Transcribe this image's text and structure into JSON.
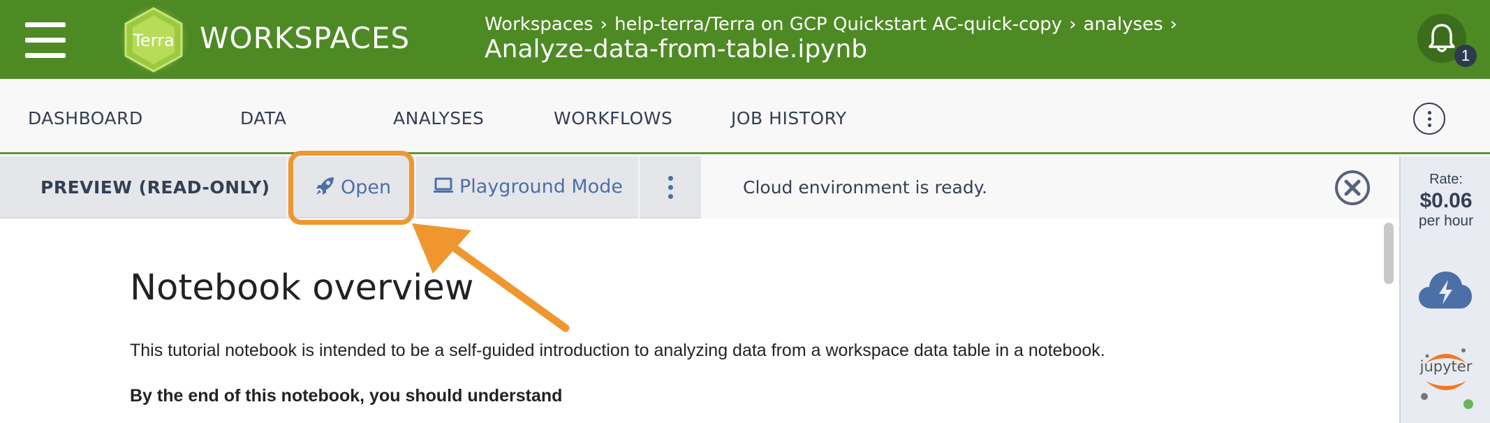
{
  "header": {
    "brand": "WORKSPACES",
    "logo_text": "Terra",
    "breadcrumb": [
      "Workspaces",
      "help-terra/Terra on GCP Quickstart AC-quick-copy",
      "analyses"
    ],
    "breadcrumb_separator": "›",
    "title": "Analyze-data-from-table.ipynb",
    "notification_count": "1",
    "icons": [
      "hamburger-menu-icon",
      "terra-logo",
      "bell-icon"
    ],
    "colors": {
      "brand_green": "#4d8a24",
      "badge": "#2c3a4e"
    }
  },
  "tabs": [
    {
      "label": "DASHBOARD"
    },
    {
      "label": "DATA"
    },
    {
      "label": "ANALYSES"
    },
    {
      "label": "WORKFLOWS"
    },
    {
      "label": "JOB HISTORY"
    }
  ],
  "toolbar": {
    "mode_label": "PREVIEW (READ-ONLY)",
    "open_label": "Open",
    "playground_label": "Playground Mode",
    "status_message": "Cloud environment is ready.",
    "icons": [
      "rocket-icon",
      "laptop-icon",
      "vertical-dots-icon",
      "close-circle-icon"
    ],
    "colors": {
      "link": "#4d6fa8",
      "highlight": "#f0962f"
    }
  },
  "side_panel": {
    "rate_label": "Rate:",
    "rate_value": "$0.06",
    "rate_unit": "per hour",
    "jupyter_label": "jupyter",
    "icons": [
      "cloud-lightning-icon",
      "jupyter-icon"
    ],
    "colors": {
      "cloud": "#4d6fa8",
      "running_dot": "#6cb35a"
    }
  },
  "notebook": {
    "title": "Notebook overview",
    "intro": "This tutorial notebook is intended to be a self-guided introduction to analyzing data from a workspace data table in a notebook.",
    "objectives_heading": "By the end of this notebook, you should understand"
  }
}
